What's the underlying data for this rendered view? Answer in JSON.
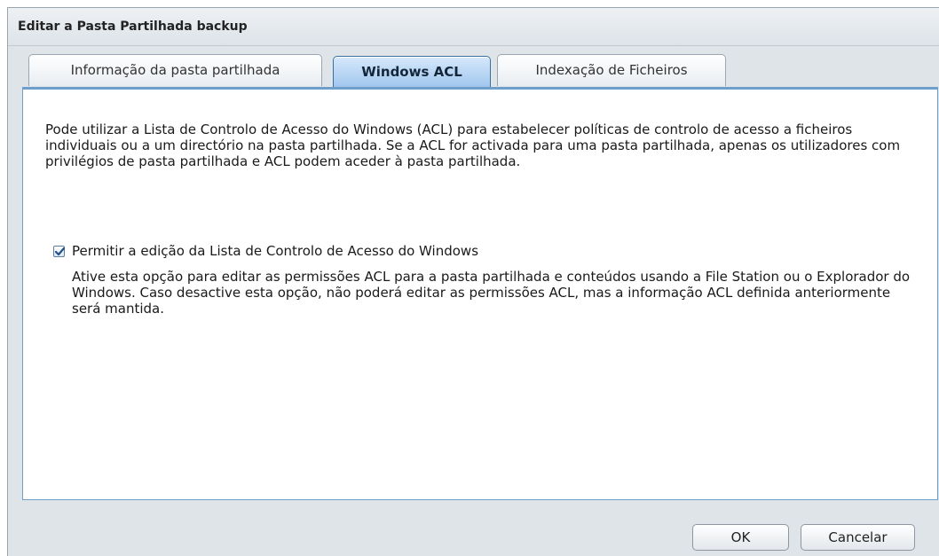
{
  "dialog": {
    "title": "Editar a Pasta Partilhada backup"
  },
  "tabs": [
    {
      "label": "Informação da pasta partilhada",
      "active": false
    },
    {
      "label": "Windows ACL",
      "active": true
    },
    {
      "label": "Indexação de Ficheiros",
      "active": false
    }
  ],
  "panel": {
    "description": "Pode utilizar a Lista de Controlo de Acesso do Windows (ACL) para estabelecer políticas de controlo de acesso a ficheiros individuais ou a um directório na pasta partilhada. Se a ACL for activada para uma pasta partilhada, apenas os utilizadores com privilégios de pasta partilhada e ACL podem aceder à pasta partilhada.",
    "option": {
      "label": "Permitir a edição da Lista de Controlo de Acesso do Windows",
      "checked": true,
      "hint": "Ative esta opção para editar as permissões ACL para a pasta partilhada e conteúdos usando a File Station ou o Explorador do Windows. Caso desactive esta opção, não poderá editar as permissões ACL, mas a informação ACL definida anteriormente será mantida."
    }
  },
  "footer": {
    "ok_label": "OK",
    "cancel_label": "Cancelar"
  },
  "colors": {
    "active_tab": "#9fc5ee",
    "panel_border": "#6e9fcb",
    "dialog_bg": "#dfe4e9"
  },
  "icons": {
    "checkbox": "checkmark-icon"
  }
}
